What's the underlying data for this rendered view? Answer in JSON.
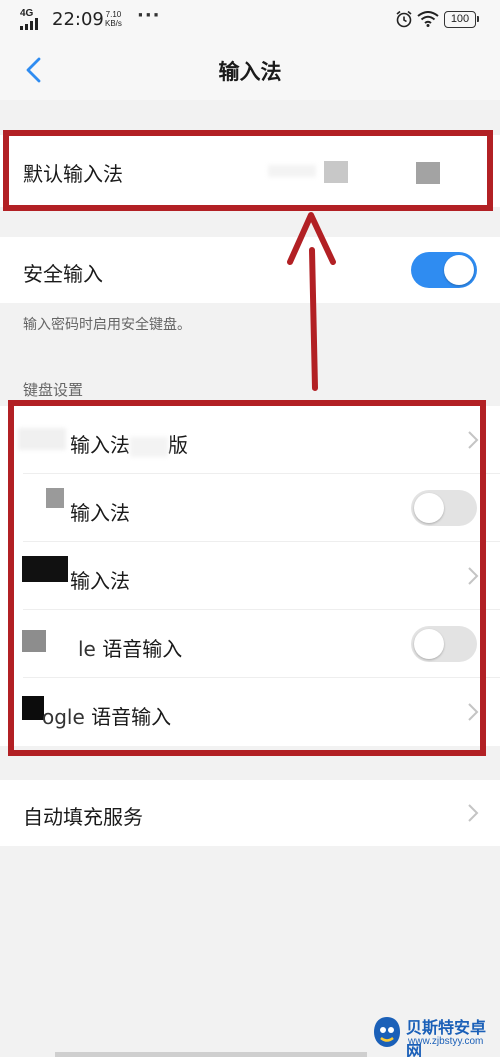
{
  "status_bar": {
    "network": "4G",
    "time": "22:09",
    "speed_value": "7.10",
    "speed_unit": "KB/s",
    "more": "···",
    "battery": "100"
  },
  "nav": {
    "back_icon": "chevron-left-icon",
    "title": "输入法"
  },
  "default_ime": {
    "label": "默认输入法"
  },
  "secure_input": {
    "label": "安全输入",
    "enabled": true,
    "hint": "输入密码时启用安全键盘。"
  },
  "keyboard_settings": {
    "header": "键盘设置",
    "items": [
      {
        "pre": "",
        "label": "输入法",
        "suffix": "版",
        "control": "chevron"
      },
      {
        "pre": "",
        "label": "输入法",
        "suffix": "",
        "control": "toggle",
        "enabled": false
      },
      {
        "pre": "",
        "label": "输入法",
        "suffix": "",
        "control": "chevron"
      },
      {
        "pre": "le",
        "label": "语音输入",
        "suffix": "",
        "control": "toggle",
        "enabled": false
      },
      {
        "pre": "ogle",
        "label": "语音输入",
        "suffix": "",
        "control": "chevron"
      }
    ]
  },
  "autofill": {
    "label": "自动填充服务"
  },
  "colors": {
    "accent": "#2f8cf1",
    "annotation": "#b22024",
    "background": "#f2f2f2"
  },
  "watermark": {
    "name": "贝斯特安卓网",
    "url": "www.zjbstyy.com"
  }
}
